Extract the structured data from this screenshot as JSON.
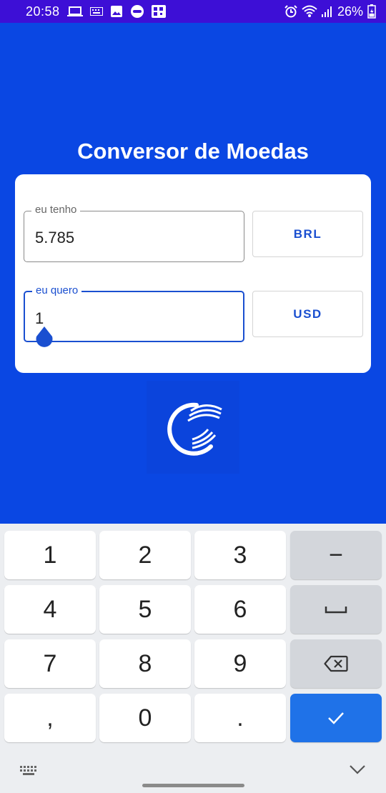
{
  "status_bar": {
    "time": "20:58",
    "battery": "26%",
    "left_icons": [
      "laptop-icon",
      "keyboard-icon",
      "gallery-icon",
      "deli-icon",
      "qr-icon"
    ],
    "right_icons": [
      "alarm-icon",
      "wifi-icon",
      "signal-icon",
      "battery-icon"
    ]
  },
  "app": {
    "title": "Conversor de Moedas",
    "have_label": "eu tenho",
    "have_value": "5.785",
    "have_currency": "BRL",
    "want_label": "eu quero",
    "want_value": "1",
    "want_currency": "USD",
    "logo_icon": "app-logo-icon"
  },
  "keyboard": {
    "keys": [
      "1",
      "2",
      "3",
      "−",
      "4",
      "5",
      "6",
      "space",
      "7",
      "8",
      "9",
      "backspace",
      ",",
      "0",
      ".",
      "done"
    ],
    "bottom_left_icon": "keyboard-icon",
    "bottom_right_icon": "chevron-down-icon"
  },
  "colors": {
    "background": "#0a47e3",
    "status_bar": "#3d0fd6",
    "accent": "#1a4fd0",
    "done_key": "#1f72e8"
  }
}
